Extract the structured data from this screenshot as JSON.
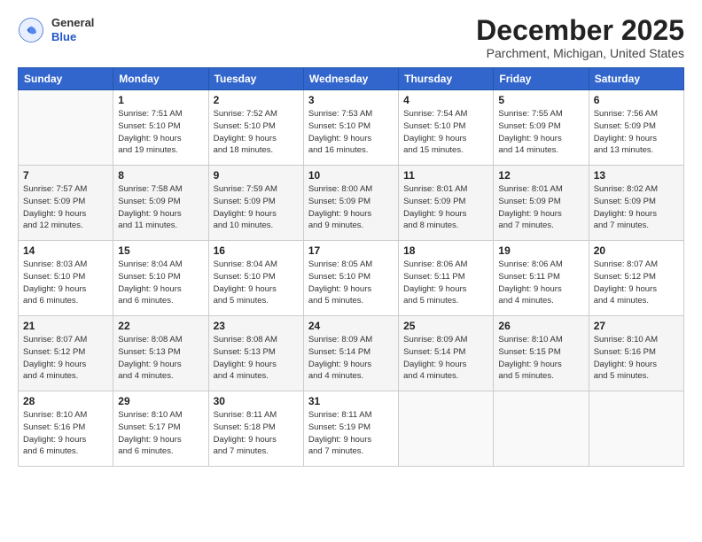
{
  "header": {
    "logo": {
      "general": "General",
      "blue": "Blue"
    },
    "title": "December 2025",
    "location": "Parchment, Michigan, United States"
  },
  "calendar": {
    "days_of_week": [
      "Sunday",
      "Monday",
      "Tuesday",
      "Wednesday",
      "Thursday",
      "Friday",
      "Saturday"
    ],
    "weeks": [
      [
        {
          "day": "",
          "info": ""
        },
        {
          "day": "1",
          "info": "Sunrise: 7:51 AM\nSunset: 5:10 PM\nDaylight: 9 hours\nand 19 minutes."
        },
        {
          "day": "2",
          "info": "Sunrise: 7:52 AM\nSunset: 5:10 PM\nDaylight: 9 hours\nand 18 minutes."
        },
        {
          "day": "3",
          "info": "Sunrise: 7:53 AM\nSunset: 5:10 PM\nDaylight: 9 hours\nand 16 minutes."
        },
        {
          "day": "4",
          "info": "Sunrise: 7:54 AM\nSunset: 5:10 PM\nDaylight: 9 hours\nand 15 minutes."
        },
        {
          "day": "5",
          "info": "Sunrise: 7:55 AM\nSunset: 5:09 PM\nDaylight: 9 hours\nand 14 minutes."
        },
        {
          "day": "6",
          "info": "Sunrise: 7:56 AM\nSunset: 5:09 PM\nDaylight: 9 hours\nand 13 minutes."
        }
      ],
      [
        {
          "day": "7",
          "info": "Sunrise: 7:57 AM\nSunset: 5:09 PM\nDaylight: 9 hours\nand 12 minutes."
        },
        {
          "day": "8",
          "info": "Sunrise: 7:58 AM\nSunset: 5:09 PM\nDaylight: 9 hours\nand 11 minutes."
        },
        {
          "day": "9",
          "info": "Sunrise: 7:59 AM\nSunset: 5:09 PM\nDaylight: 9 hours\nand 10 minutes."
        },
        {
          "day": "10",
          "info": "Sunrise: 8:00 AM\nSunset: 5:09 PM\nDaylight: 9 hours\nand 9 minutes."
        },
        {
          "day": "11",
          "info": "Sunrise: 8:01 AM\nSunset: 5:09 PM\nDaylight: 9 hours\nand 8 minutes."
        },
        {
          "day": "12",
          "info": "Sunrise: 8:01 AM\nSunset: 5:09 PM\nDaylight: 9 hours\nand 7 minutes."
        },
        {
          "day": "13",
          "info": "Sunrise: 8:02 AM\nSunset: 5:09 PM\nDaylight: 9 hours\nand 7 minutes."
        }
      ],
      [
        {
          "day": "14",
          "info": "Sunrise: 8:03 AM\nSunset: 5:10 PM\nDaylight: 9 hours\nand 6 minutes."
        },
        {
          "day": "15",
          "info": "Sunrise: 8:04 AM\nSunset: 5:10 PM\nDaylight: 9 hours\nand 6 minutes."
        },
        {
          "day": "16",
          "info": "Sunrise: 8:04 AM\nSunset: 5:10 PM\nDaylight: 9 hours\nand 5 minutes."
        },
        {
          "day": "17",
          "info": "Sunrise: 8:05 AM\nSunset: 5:10 PM\nDaylight: 9 hours\nand 5 minutes."
        },
        {
          "day": "18",
          "info": "Sunrise: 8:06 AM\nSunset: 5:11 PM\nDaylight: 9 hours\nand 5 minutes."
        },
        {
          "day": "19",
          "info": "Sunrise: 8:06 AM\nSunset: 5:11 PM\nDaylight: 9 hours\nand 4 minutes."
        },
        {
          "day": "20",
          "info": "Sunrise: 8:07 AM\nSunset: 5:12 PM\nDaylight: 9 hours\nand 4 minutes."
        }
      ],
      [
        {
          "day": "21",
          "info": "Sunrise: 8:07 AM\nSunset: 5:12 PM\nDaylight: 9 hours\nand 4 minutes."
        },
        {
          "day": "22",
          "info": "Sunrise: 8:08 AM\nSunset: 5:13 PM\nDaylight: 9 hours\nand 4 minutes."
        },
        {
          "day": "23",
          "info": "Sunrise: 8:08 AM\nSunset: 5:13 PM\nDaylight: 9 hours\nand 4 minutes."
        },
        {
          "day": "24",
          "info": "Sunrise: 8:09 AM\nSunset: 5:14 PM\nDaylight: 9 hours\nand 4 minutes."
        },
        {
          "day": "25",
          "info": "Sunrise: 8:09 AM\nSunset: 5:14 PM\nDaylight: 9 hours\nand 4 minutes."
        },
        {
          "day": "26",
          "info": "Sunrise: 8:10 AM\nSunset: 5:15 PM\nDaylight: 9 hours\nand 5 minutes."
        },
        {
          "day": "27",
          "info": "Sunrise: 8:10 AM\nSunset: 5:16 PM\nDaylight: 9 hours\nand 5 minutes."
        }
      ],
      [
        {
          "day": "28",
          "info": "Sunrise: 8:10 AM\nSunset: 5:16 PM\nDaylight: 9 hours\nand 6 minutes."
        },
        {
          "day": "29",
          "info": "Sunrise: 8:10 AM\nSunset: 5:17 PM\nDaylight: 9 hours\nand 6 minutes."
        },
        {
          "day": "30",
          "info": "Sunrise: 8:11 AM\nSunset: 5:18 PM\nDaylight: 9 hours\nand 7 minutes."
        },
        {
          "day": "31",
          "info": "Sunrise: 8:11 AM\nSunset: 5:19 PM\nDaylight: 9 hours\nand 7 minutes."
        },
        {
          "day": "",
          "info": ""
        },
        {
          "day": "",
          "info": ""
        },
        {
          "day": "",
          "info": ""
        }
      ]
    ]
  }
}
